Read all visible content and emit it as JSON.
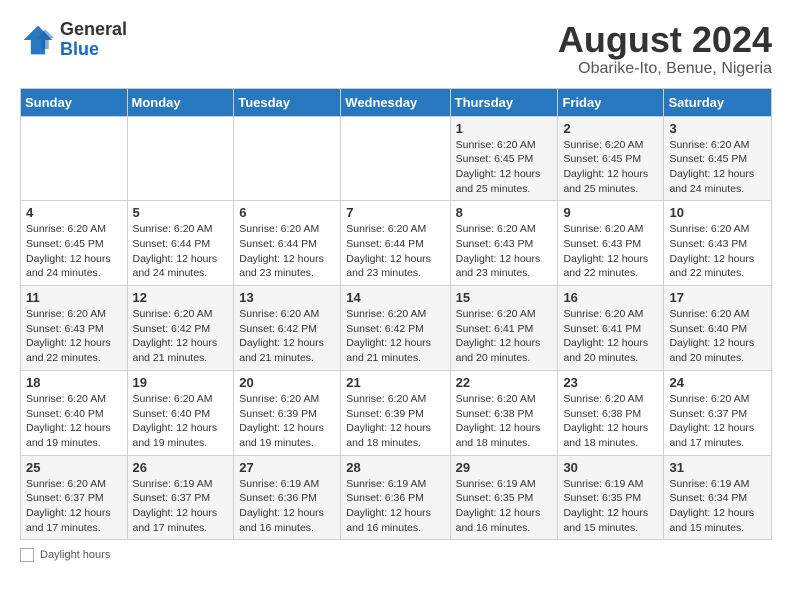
{
  "logo": {
    "general": "General",
    "blue": "Blue"
  },
  "title": {
    "month_year": "August 2024",
    "location": "Obarike-Ito, Benue, Nigeria"
  },
  "headers": [
    "Sunday",
    "Monday",
    "Tuesday",
    "Wednesday",
    "Thursday",
    "Friday",
    "Saturday"
  ],
  "legend": {
    "label": "Daylight hours"
  },
  "weeks": [
    [
      {
        "day": "",
        "info": ""
      },
      {
        "day": "",
        "info": ""
      },
      {
        "day": "",
        "info": ""
      },
      {
        "day": "",
        "info": ""
      },
      {
        "day": "1",
        "info": "Sunrise: 6:20 AM\nSunset: 6:45 PM\nDaylight: 12 hours\nand 25 minutes."
      },
      {
        "day": "2",
        "info": "Sunrise: 6:20 AM\nSunset: 6:45 PM\nDaylight: 12 hours\nand 25 minutes."
      },
      {
        "day": "3",
        "info": "Sunrise: 6:20 AM\nSunset: 6:45 PM\nDaylight: 12 hours\nand 24 minutes."
      }
    ],
    [
      {
        "day": "4",
        "info": "Sunrise: 6:20 AM\nSunset: 6:45 PM\nDaylight: 12 hours\nand 24 minutes."
      },
      {
        "day": "5",
        "info": "Sunrise: 6:20 AM\nSunset: 6:44 PM\nDaylight: 12 hours\nand 24 minutes."
      },
      {
        "day": "6",
        "info": "Sunrise: 6:20 AM\nSunset: 6:44 PM\nDaylight: 12 hours\nand 23 minutes."
      },
      {
        "day": "7",
        "info": "Sunrise: 6:20 AM\nSunset: 6:44 PM\nDaylight: 12 hours\nand 23 minutes."
      },
      {
        "day": "8",
        "info": "Sunrise: 6:20 AM\nSunset: 6:43 PM\nDaylight: 12 hours\nand 23 minutes."
      },
      {
        "day": "9",
        "info": "Sunrise: 6:20 AM\nSunset: 6:43 PM\nDaylight: 12 hours\nand 22 minutes."
      },
      {
        "day": "10",
        "info": "Sunrise: 6:20 AM\nSunset: 6:43 PM\nDaylight: 12 hours\nand 22 minutes."
      }
    ],
    [
      {
        "day": "11",
        "info": "Sunrise: 6:20 AM\nSunset: 6:43 PM\nDaylight: 12 hours\nand 22 minutes."
      },
      {
        "day": "12",
        "info": "Sunrise: 6:20 AM\nSunset: 6:42 PM\nDaylight: 12 hours\nand 21 minutes."
      },
      {
        "day": "13",
        "info": "Sunrise: 6:20 AM\nSunset: 6:42 PM\nDaylight: 12 hours\nand 21 minutes."
      },
      {
        "day": "14",
        "info": "Sunrise: 6:20 AM\nSunset: 6:42 PM\nDaylight: 12 hours\nand 21 minutes."
      },
      {
        "day": "15",
        "info": "Sunrise: 6:20 AM\nSunset: 6:41 PM\nDaylight: 12 hours\nand 20 minutes."
      },
      {
        "day": "16",
        "info": "Sunrise: 6:20 AM\nSunset: 6:41 PM\nDaylight: 12 hours\nand 20 minutes."
      },
      {
        "day": "17",
        "info": "Sunrise: 6:20 AM\nSunset: 6:40 PM\nDaylight: 12 hours\nand 20 minutes."
      }
    ],
    [
      {
        "day": "18",
        "info": "Sunrise: 6:20 AM\nSunset: 6:40 PM\nDaylight: 12 hours\nand 19 minutes."
      },
      {
        "day": "19",
        "info": "Sunrise: 6:20 AM\nSunset: 6:40 PM\nDaylight: 12 hours\nand 19 minutes."
      },
      {
        "day": "20",
        "info": "Sunrise: 6:20 AM\nSunset: 6:39 PM\nDaylight: 12 hours\nand 19 minutes."
      },
      {
        "day": "21",
        "info": "Sunrise: 6:20 AM\nSunset: 6:39 PM\nDaylight: 12 hours\nand 18 minutes."
      },
      {
        "day": "22",
        "info": "Sunrise: 6:20 AM\nSunset: 6:38 PM\nDaylight: 12 hours\nand 18 minutes."
      },
      {
        "day": "23",
        "info": "Sunrise: 6:20 AM\nSunset: 6:38 PM\nDaylight: 12 hours\nand 18 minutes."
      },
      {
        "day": "24",
        "info": "Sunrise: 6:20 AM\nSunset: 6:37 PM\nDaylight: 12 hours\nand 17 minutes."
      }
    ],
    [
      {
        "day": "25",
        "info": "Sunrise: 6:20 AM\nSunset: 6:37 PM\nDaylight: 12 hours\nand 17 minutes."
      },
      {
        "day": "26",
        "info": "Sunrise: 6:19 AM\nSunset: 6:37 PM\nDaylight: 12 hours\nand 17 minutes."
      },
      {
        "day": "27",
        "info": "Sunrise: 6:19 AM\nSunset: 6:36 PM\nDaylight: 12 hours\nand 16 minutes."
      },
      {
        "day": "28",
        "info": "Sunrise: 6:19 AM\nSunset: 6:36 PM\nDaylight: 12 hours\nand 16 minutes."
      },
      {
        "day": "29",
        "info": "Sunrise: 6:19 AM\nSunset: 6:35 PM\nDaylight: 12 hours\nand 16 minutes."
      },
      {
        "day": "30",
        "info": "Sunrise: 6:19 AM\nSunset: 6:35 PM\nDaylight: 12 hours\nand 15 minutes."
      },
      {
        "day": "31",
        "info": "Sunrise: 6:19 AM\nSunset: 6:34 PM\nDaylight: 12 hours\nand 15 minutes."
      }
    ]
  ]
}
